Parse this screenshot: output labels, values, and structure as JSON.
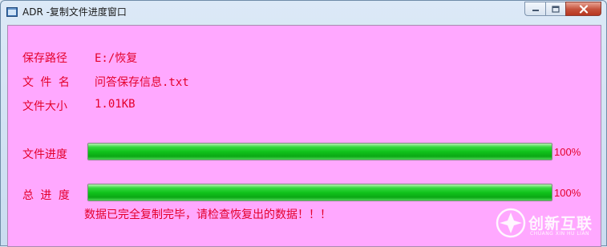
{
  "window": {
    "title": "ADR -复制文件进度窗口"
  },
  "info": {
    "path_label": "保存路径",
    "path_value": "E:/恢复",
    "name_label": "文 件 名",
    "name_value": "问答保存信息.txt",
    "size_label": "文件大小",
    "size_value": "1.01KB"
  },
  "progress": {
    "file_label": "文件进度",
    "file_value": 1.0,
    "file_percent": "100%",
    "total_label": "总 进 度",
    "total_value": 1.0,
    "total_percent": "100%"
  },
  "status": {
    "message": "数据已完全复制完毕，请检查恢复出的数据！！！"
  },
  "watermark": {
    "brand_cn": "创新互联",
    "brand_en": "CHUANG XIN HU LIAN"
  },
  "colors": {
    "client_bg": "#ffa8ff",
    "text": "#e4002b",
    "bar_fill": "#11c31c"
  }
}
